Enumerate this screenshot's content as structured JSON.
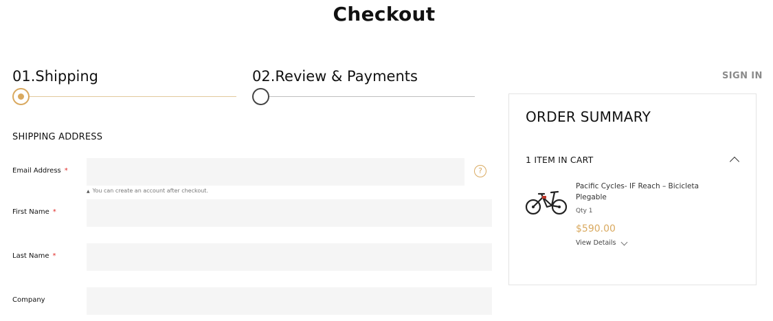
{
  "page": {
    "title": "Checkout"
  },
  "steps": [
    {
      "label": "01.Shipping",
      "state": "active"
    },
    {
      "label": "02.Review & Payments",
      "state": "inactive"
    }
  ],
  "header": {
    "sign_in": "SIGN IN"
  },
  "shipping": {
    "section_title": "SHIPPING ADDRESS",
    "required_marker": "*",
    "email_note": "You can create an account after checkout.",
    "fields": [
      {
        "label": "Email Address",
        "required": true,
        "value": "",
        "placeholder": ""
      },
      {
        "label": "First Name",
        "required": true,
        "value": "",
        "placeholder": ""
      },
      {
        "label": "Last Name",
        "required": true,
        "value": "",
        "placeholder": ""
      },
      {
        "label": "Company",
        "required": false,
        "value": "",
        "placeholder": ""
      }
    ]
  },
  "summary": {
    "title": "ORDER SUMMARY",
    "cart_count": "1 ITEM IN CART",
    "items": [
      {
        "name": "Pacific Cycles- IF Reach – Bicicleta Plegable",
        "qty": "Qty 1",
        "price": "$590.00",
        "details_label": "View Details",
        "image": "folding-bicycle"
      }
    ]
  },
  "icons": {
    "help": "question-circle-icon",
    "summary_toggle": "chevron-up-icon",
    "details_toggle": "chevron-down-icon"
  },
  "colors": {
    "accent": "#d9a95f",
    "required": "#e02b27",
    "input_bg": "#f5f5f5",
    "border": "#e3e3e3"
  }
}
